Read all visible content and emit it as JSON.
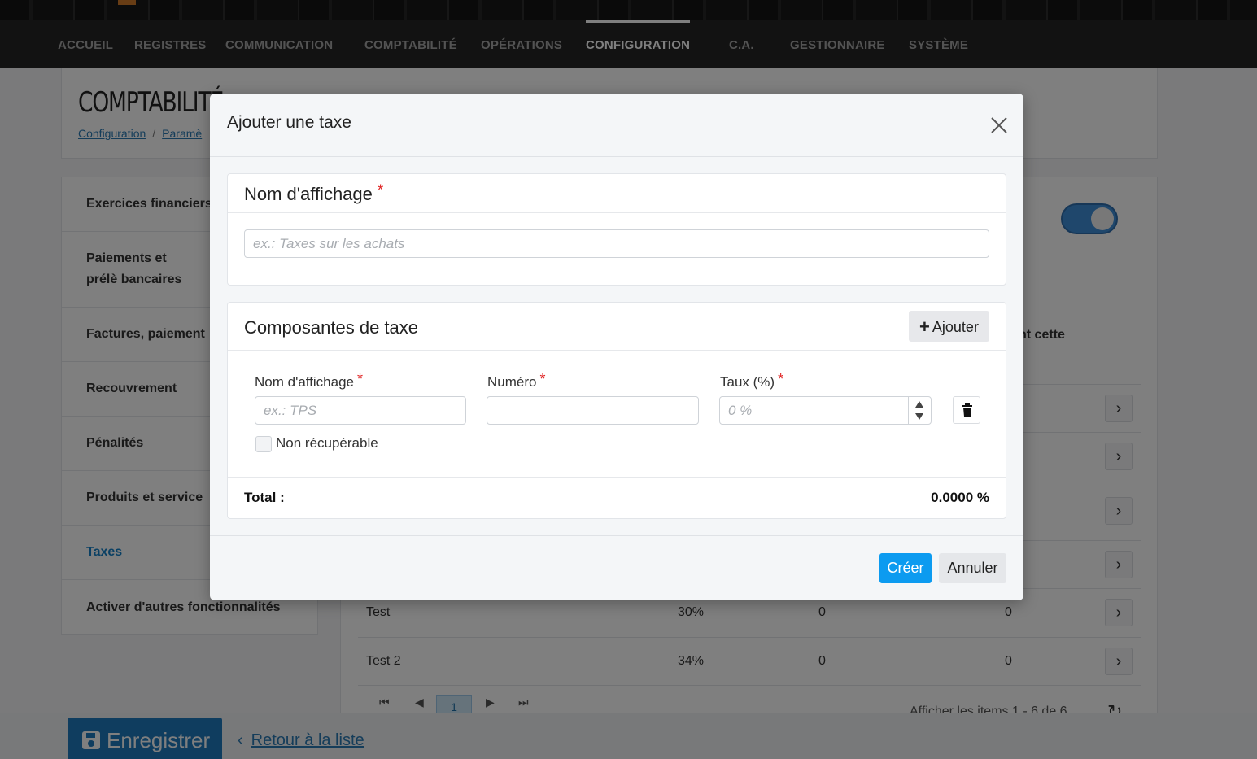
{
  "nav": {
    "items": [
      "ACCUEIL",
      "REGISTRES",
      "COMMUNICATION",
      "COMPTABILITÉ",
      "OPÉRATIONS",
      "CONFIGURATION",
      "C.A.",
      "GESTIONNAIRE",
      "SYSTÈME"
    ],
    "active": "CONFIGURATION"
  },
  "header": {
    "title": "COMPTABILITÉ",
    "breadcrumb": [
      "Configuration",
      "Paramè"
    ],
    "breadcrumb_sep": "/"
  },
  "sidebar": {
    "items": [
      {
        "label": "Exercices financiers"
      },
      {
        "label": "Paiements et prélè bancaires"
      },
      {
        "label": "Factures, paiement"
      },
      {
        "label": "Recouvrement"
      },
      {
        "label": "Pénalités"
      },
      {
        "label": "Produits et service"
      },
      {
        "label": "Taxes"
      },
      {
        "label": "Activer d'autres fonctionnalités"
      }
    ],
    "active": "Taxes"
  },
  "main": {
    "column_header_partial": "nt cette",
    "rows": [
      {
        "name": "Test",
        "rate": "30%",
        "col3": "0",
        "col4": "0"
      },
      {
        "name": "Test 2",
        "rate": "34%",
        "col3": "0",
        "col4": "0"
      }
    ],
    "pager": {
      "current_page": "1",
      "info": "Afficher les items 1 - 6 de 6"
    }
  },
  "footer": {
    "save_label": "Enregistrer",
    "back_label": "Retour à la liste"
  },
  "modal": {
    "title": "Ajouter une taxe",
    "display_name_section": {
      "title": "Nom d'affichage",
      "required_mark": "*",
      "placeholder": "ex.: Taxes sur les achats"
    },
    "components_section": {
      "title": "Composantes de taxe",
      "add_label": "Ajouter",
      "fields": {
        "name_label": "Nom d'affichage",
        "name_placeholder": "ex.: TPS",
        "number_label": "Numéro",
        "rate_label": "Taux (%)",
        "rate_placeholder": "0 %",
        "required_mark": "*"
      },
      "non_recoverable_label": "Non récupérable",
      "total_label": "Total :",
      "total_value": "0.0000 %"
    },
    "create_label": "Créer",
    "cancel_label": "Annuler"
  }
}
